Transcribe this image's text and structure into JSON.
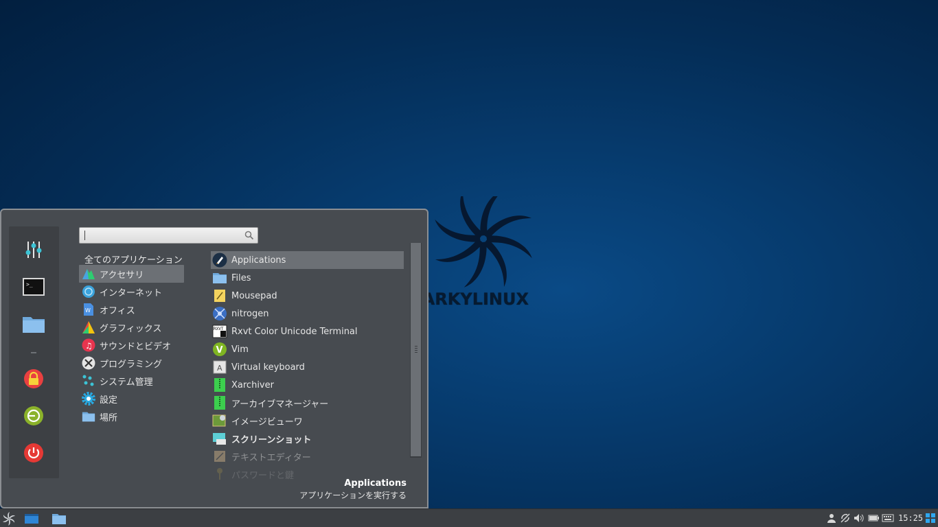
{
  "desktop": {
    "logo_text": "SPARKYLINUX"
  },
  "menu": {
    "search": {
      "value": "",
      "placeholder": ""
    },
    "favorites": [
      {
        "icon": "settings-sliders-icon"
      },
      {
        "icon": "terminal-icon"
      },
      {
        "icon": "folder-icon"
      },
      {
        "icon": "lock-icon"
      },
      {
        "icon": "logout-icon"
      },
      {
        "icon": "power-icon"
      }
    ],
    "categories_header": "全てのアプリケーション",
    "categories": [
      {
        "label": "アクセサリ",
        "icon": "accessories-icon",
        "selected": true
      },
      {
        "label": "インターネット",
        "icon": "internet-icon"
      },
      {
        "label": "オフィス",
        "icon": "office-icon"
      },
      {
        "label": "グラフィックス",
        "icon": "graphics-icon"
      },
      {
        "label": "サウンドとビデオ",
        "icon": "music-icon"
      },
      {
        "label": "プログラミング",
        "icon": "programming-icon"
      },
      {
        "label": "システム管理",
        "icon": "system-icon"
      },
      {
        "label": "設定",
        "icon": "settings-gear-icon"
      },
      {
        "label": "場所",
        "icon": "places-folder-icon"
      }
    ],
    "apps": [
      {
        "label": "Applications",
        "icon": "rocket-icon",
        "selected": true
      },
      {
        "label": "Files",
        "icon": "folder-icon"
      },
      {
        "label": "Mousepad",
        "icon": "mousepad-icon"
      },
      {
        "label": "nitrogen",
        "icon": "nitrogen-icon"
      },
      {
        "label": "Rxvt Color Unicode Terminal",
        "icon": "rxvt-icon"
      },
      {
        "label": "Vim",
        "icon": "vim-icon"
      },
      {
        "label": "Virtual keyboard",
        "icon": "keyboard-icon"
      },
      {
        "label": "Xarchiver",
        "icon": "archive-icon"
      },
      {
        "label": "アーカイブマネージャー",
        "icon": "archive-manager-icon"
      },
      {
        "label": "イメージビューワ",
        "icon": "image-viewer-icon"
      },
      {
        "label": "スクリーンショット",
        "icon": "screenshot-icon",
        "bold": true
      },
      {
        "label": "テキストエディター",
        "icon": "text-editor-icon",
        "dim": true
      },
      {
        "label": "パスワードと鍵",
        "icon": "key-icon",
        "faded": true
      }
    ],
    "description": {
      "title": "Applications",
      "subtitle": "アプリケーションを実行する"
    }
  },
  "taskbar": {
    "launchers": [
      "sparky-menu-icon",
      "desktop-icon",
      "folder-icon"
    ],
    "tray": [
      "user-icon",
      "network-icon",
      "volume-icon",
      "battery-icon",
      "keyboard-icon"
    ],
    "clock": "15:25"
  },
  "colors": {
    "menu_bg": "#474b50",
    "selection": "#6c7075",
    "taskbar_bg": "#3c3f43"
  }
}
